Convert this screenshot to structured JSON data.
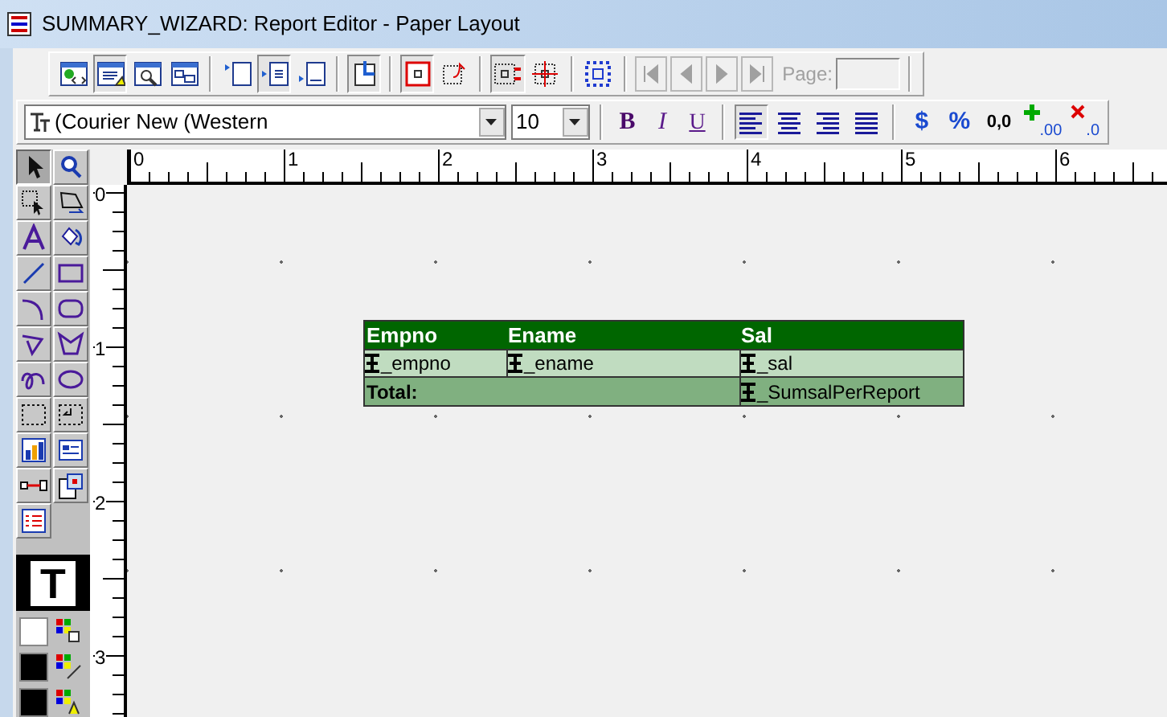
{
  "window": {
    "title": "SUMMARY_WIZARD: Report Editor - Paper Layout"
  },
  "toolbar_1": {
    "groups": [
      [
        {
          "kind": "web-source",
          "selected": false
        },
        {
          "kind": "paper-design",
          "selected": true
        },
        {
          "kind": "preview",
          "selected": false
        },
        {
          "kind": "data-model",
          "selected": false
        }
      ],
      [
        {
          "kind": "header",
          "selected": false
        },
        {
          "kind": "main",
          "selected": true
        },
        {
          "kind": "trailer",
          "selected": false
        }
      ],
      [
        {
          "kind": "confine",
          "selected": true
        }
      ],
      [
        {
          "kind": "flex-frame",
          "selected": true
        },
        {
          "kind": "flex-move",
          "selected": false
        }
      ],
      [
        {
          "kind": "align",
          "selected": true
        },
        {
          "kind": "distribute",
          "selected": false
        }
      ],
      [
        {
          "kind": "select-parent",
          "selected": false
        }
      ]
    ],
    "navigation": [
      {
        "kind": "first"
      },
      {
        "kind": "previous"
      },
      {
        "kind": "next"
      },
      {
        "kind": "last"
      }
    ],
    "page_label": "Page:",
    "navigation_disabled": true
  },
  "toolbar_2": {
    "font": "(Courier New (Western",
    "size": "10",
    "styles": [
      {
        "label": "B",
        "kind": "bold"
      },
      {
        "label": "I",
        "kind": "italic"
      },
      {
        "label": "U",
        "kind": "underline"
      }
    ],
    "alignments": [
      {
        "kind": "left",
        "selected": true
      },
      {
        "kind": "center",
        "selected": false
      },
      {
        "kind": "right",
        "selected": false
      },
      {
        "kind": "justify",
        "selected": false
      }
    ],
    "formats": [
      {
        "kind": "currency",
        "label": "$"
      },
      {
        "kind": "percent",
        "label": "%"
      },
      {
        "kind": "commas",
        "label": "0,0"
      },
      {
        "kind": "add-decimal",
        "label": ".00"
      },
      {
        "kind": "remove-decimal",
        "label": ".0"
      }
    ]
  },
  "tool_palette": {
    "tools": [
      {
        "kind": "select",
        "selected": true
      },
      {
        "kind": "magnify",
        "selected": false
      },
      {
        "kind": "frame-select",
        "selected": false
      },
      {
        "kind": "reshape",
        "selected": false
      },
      {
        "kind": "text",
        "selected": false
      },
      {
        "kind": "rotate",
        "selected": false
      },
      {
        "kind": "line",
        "selected": false
      },
      {
        "kind": "rectangle",
        "selected": false
      },
      {
        "kind": "arc",
        "selected": false
      },
      {
        "kind": "rounded-rectangle",
        "selected": false
      },
      {
        "kind": "polyline",
        "selected": false
      },
      {
        "kind": "polygon",
        "selected": false
      },
      {
        "kind": "freehand",
        "selected": false
      },
      {
        "kind": "ellipse",
        "selected": false
      },
      {
        "kind": "frame",
        "selected": false
      },
      {
        "kind": "repeating-frame",
        "selected": false
      },
      {
        "kind": "chart",
        "selected": false
      },
      {
        "kind": "form",
        "selected": false
      },
      {
        "kind": "link",
        "selected": false
      },
      {
        "kind": "ole",
        "selected": false
      },
      {
        "kind": "field-list",
        "selected": false
      }
    ],
    "text_sample": "T",
    "swatches": [
      {
        "kind": "fill",
        "color": "#ffffff"
      },
      {
        "kind": "line",
        "color": "#000000"
      },
      {
        "kind": "text",
        "color": "#000000"
      }
    ]
  },
  "rulers": {
    "horizontal": [
      "0",
      "1",
      "2",
      "3",
      "4",
      "5",
      "6"
    ],
    "vertical": [
      "0",
      "1",
      "2",
      "3"
    ]
  },
  "report": {
    "columns": [
      "Empno",
      "Ename",
      "Sal"
    ],
    "rows": [
      [
        "_empno",
        "_ename",
        "_sal"
      ]
    ],
    "total": {
      "label": "Total:",
      "value": "_SumsalPerReport"
    }
  }
}
